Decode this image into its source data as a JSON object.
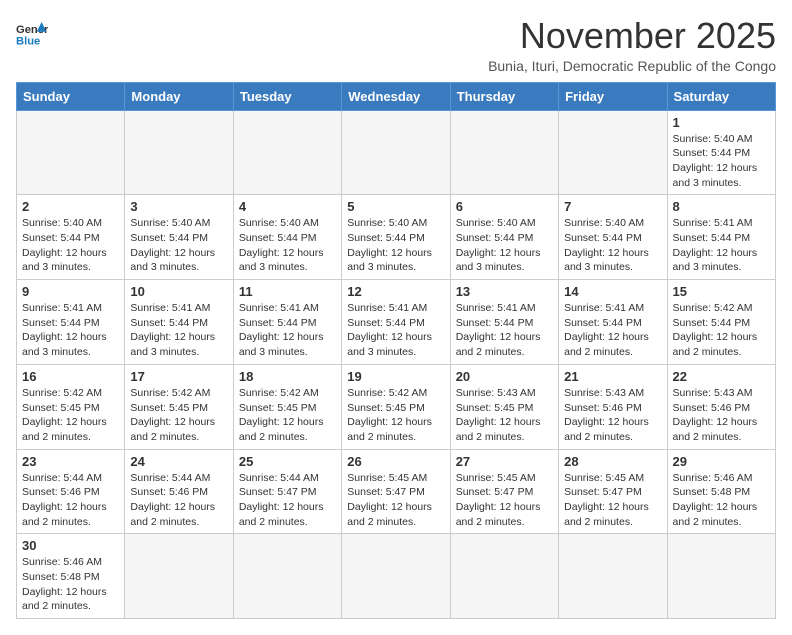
{
  "logo": {
    "text_general": "General",
    "text_blue": "Blue"
  },
  "title": "November 2025",
  "subtitle": "Bunia, Ituri, Democratic Republic of the Congo",
  "weekdays": [
    "Sunday",
    "Monday",
    "Tuesday",
    "Wednesday",
    "Thursday",
    "Friday",
    "Saturday"
  ],
  "weeks": [
    [
      {
        "day": null,
        "info": ""
      },
      {
        "day": null,
        "info": ""
      },
      {
        "day": null,
        "info": ""
      },
      {
        "day": null,
        "info": ""
      },
      {
        "day": null,
        "info": ""
      },
      {
        "day": null,
        "info": ""
      },
      {
        "day": "1",
        "info": "Sunrise: 5:40 AM\nSunset: 5:44 PM\nDaylight: 12 hours and 3 minutes."
      }
    ],
    [
      {
        "day": "2",
        "info": "Sunrise: 5:40 AM\nSunset: 5:44 PM\nDaylight: 12 hours and 3 minutes."
      },
      {
        "day": "3",
        "info": "Sunrise: 5:40 AM\nSunset: 5:44 PM\nDaylight: 12 hours and 3 minutes."
      },
      {
        "day": "4",
        "info": "Sunrise: 5:40 AM\nSunset: 5:44 PM\nDaylight: 12 hours and 3 minutes."
      },
      {
        "day": "5",
        "info": "Sunrise: 5:40 AM\nSunset: 5:44 PM\nDaylight: 12 hours and 3 minutes."
      },
      {
        "day": "6",
        "info": "Sunrise: 5:40 AM\nSunset: 5:44 PM\nDaylight: 12 hours and 3 minutes."
      },
      {
        "day": "7",
        "info": "Sunrise: 5:40 AM\nSunset: 5:44 PM\nDaylight: 12 hours and 3 minutes."
      },
      {
        "day": "8",
        "info": "Sunrise: 5:41 AM\nSunset: 5:44 PM\nDaylight: 12 hours and 3 minutes."
      }
    ],
    [
      {
        "day": "9",
        "info": "Sunrise: 5:41 AM\nSunset: 5:44 PM\nDaylight: 12 hours and 3 minutes."
      },
      {
        "day": "10",
        "info": "Sunrise: 5:41 AM\nSunset: 5:44 PM\nDaylight: 12 hours and 3 minutes."
      },
      {
        "day": "11",
        "info": "Sunrise: 5:41 AM\nSunset: 5:44 PM\nDaylight: 12 hours and 3 minutes."
      },
      {
        "day": "12",
        "info": "Sunrise: 5:41 AM\nSunset: 5:44 PM\nDaylight: 12 hours and 3 minutes."
      },
      {
        "day": "13",
        "info": "Sunrise: 5:41 AM\nSunset: 5:44 PM\nDaylight: 12 hours and 2 minutes."
      },
      {
        "day": "14",
        "info": "Sunrise: 5:41 AM\nSunset: 5:44 PM\nDaylight: 12 hours and 2 minutes."
      },
      {
        "day": "15",
        "info": "Sunrise: 5:42 AM\nSunset: 5:44 PM\nDaylight: 12 hours and 2 minutes."
      }
    ],
    [
      {
        "day": "16",
        "info": "Sunrise: 5:42 AM\nSunset: 5:45 PM\nDaylight: 12 hours and 2 minutes."
      },
      {
        "day": "17",
        "info": "Sunrise: 5:42 AM\nSunset: 5:45 PM\nDaylight: 12 hours and 2 minutes."
      },
      {
        "day": "18",
        "info": "Sunrise: 5:42 AM\nSunset: 5:45 PM\nDaylight: 12 hours and 2 minutes."
      },
      {
        "day": "19",
        "info": "Sunrise: 5:42 AM\nSunset: 5:45 PM\nDaylight: 12 hours and 2 minutes."
      },
      {
        "day": "20",
        "info": "Sunrise: 5:43 AM\nSunset: 5:45 PM\nDaylight: 12 hours and 2 minutes."
      },
      {
        "day": "21",
        "info": "Sunrise: 5:43 AM\nSunset: 5:46 PM\nDaylight: 12 hours and 2 minutes."
      },
      {
        "day": "22",
        "info": "Sunrise: 5:43 AM\nSunset: 5:46 PM\nDaylight: 12 hours and 2 minutes."
      }
    ],
    [
      {
        "day": "23",
        "info": "Sunrise: 5:44 AM\nSunset: 5:46 PM\nDaylight: 12 hours and 2 minutes."
      },
      {
        "day": "24",
        "info": "Sunrise: 5:44 AM\nSunset: 5:46 PM\nDaylight: 12 hours and 2 minutes."
      },
      {
        "day": "25",
        "info": "Sunrise: 5:44 AM\nSunset: 5:47 PM\nDaylight: 12 hours and 2 minutes."
      },
      {
        "day": "26",
        "info": "Sunrise: 5:45 AM\nSunset: 5:47 PM\nDaylight: 12 hours and 2 minutes."
      },
      {
        "day": "27",
        "info": "Sunrise: 5:45 AM\nSunset: 5:47 PM\nDaylight: 12 hours and 2 minutes."
      },
      {
        "day": "28",
        "info": "Sunrise: 5:45 AM\nSunset: 5:47 PM\nDaylight: 12 hours and 2 minutes."
      },
      {
        "day": "29",
        "info": "Sunrise: 5:46 AM\nSunset: 5:48 PM\nDaylight: 12 hours and 2 minutes."
      }
    ],
    [
      {
        "day": "30",
        "info": "Sunrise: 5:46 AM\nSunset: 5:48 PM\nDaylight: 12 hours and 2 minutes."
      },
      {
        "day": null,
        "info": ""
      },
      {
        "day": null,
        "info": ""
      },
      {
        "day": null,
        "info": ""
      },
      {
        "day": null,
        "info": ""
      },
      {
        "day": null,
        "info": ""
      },
      {
        "day": null,
        "info": ""
      }
    ]
  ]
}
